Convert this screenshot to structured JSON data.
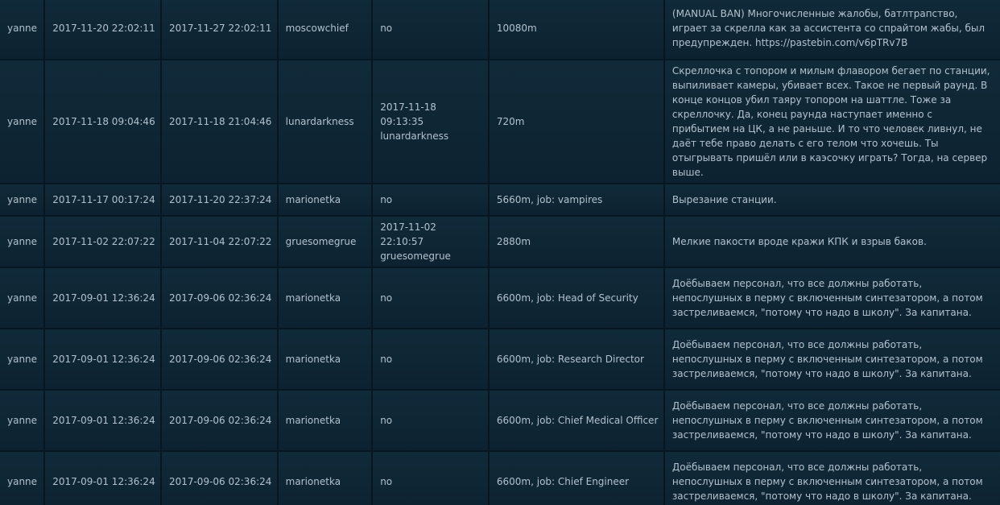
{
  "rows": [
    {
      "ckey": "yanne",
      "banned_at": "2017-11-20 22:02:11",
      "expires_at": "2017-11-27 22:02:11",
      "admin": "moscowchief",
      "unbanned": "no",
      "duration": "10080m",
      "reason": "(MANUAL BAN) Многочисленные жалобы, батлтрапство, играет за скрелла как за ассистента со спрайтом жабы, был предупрежден. https://pastebin.com/v6pTRv7B"
    },
    {
      "ckey": "yanne",
      "banned_at": "2017-11-18 09:04:46",
      "expires_at": "2017-11-18 21:04:46",
      "admin": "lunardarkness",
      "unbanned": "2017-11-18 09:13:35 lunardarkness",
      "duration": "720m",
      "reason": "Скреллочка с топором и милым флавором бегает по станции, выпиливает камеры, убивает всех. Такое не первый раунд. В конце концов убил таяру топором на шаттле. Тоже за скреллочку. Да, конец раунда наступает именно с прибытием на ЦК, а не раньше. И то что человек ливнул, не даёт тебе право делать с его телом что хочешь. Ты отыгрывать пришёл или в каэсочку играть? Тогда, на сервер выше."
    },
    {
      "ckey": "yanne",
      "banned_at": "2017-11-17 00:17:24",
      "expires_at": "2017-11-20 22:37:24",
      "admin": "marionetka",
      "unbanned": "no",
      "duration": "5660m, job: vampires",
      "reason": "Вырезание станции."
    },
    {
      "ckey": "yanne",
      "banned_at": "2017-11-02 22:07:22",
      "expires_at": "2017-11-04 22:07:22",
      "admin": "gruesomegrue",
      "unbanned": "2017-11-02 22:10:57 gruesomegrue",
      "duration": "2880m",
      "reason": "Мелкие пакости вроде кражи КПК и взрыв баков."
    },
    {
      "ckey": "yanne",
      "banned_at": "2017-09-01 12:36:24",
      "expires_at": "2017-09-06 02:36:24",
      "admin": "marionetka",
      "unbanned": "no",
      "duration": "6600m, job: Head of Security",
      "reason": "Доёбываем персонал, что все должны работать, непослушных в перму с включенным синтезатором, а потом застреливаемся, \"потому что надо в школу\". За капитана."
    },
    {
      "ckey": "yanne",
      "banned_at": "2017-09-01 12:36:24",
      "expires_at": "2017-09-06 02:36:24",
      "admin": "marionetka",
      "unbanned": "no",
      "duration": "6600m, job: Research Director",
      "reason": "Доёбываем персонал, что все должны работать, непослушных в перму с включенным синтезатором, а потом застреливаемся, \"потому что надо в школу\". За капитана."
    },
    {
      "ckey": "yanne",
      "banned_at": "2017-09-01 12:36:24",
      "expires_at": "2017-09-06 02:36:24",
      "admin": "marionetka",
      "unbanned": "no",
      "duration": "6600m, job: Chief Medical Officer",
      "reason": "Доёбываем персонал, что все должны работать, непослушных в перму с включенным синтезатором, а потом застреливаемся, \"потому что надо в школу\". За капитана."
    },
    {
      "ckey": "yanne",
      "banned_at": "2017-09-01 12:36:24",
      "expires_at": "2017-09-06 02:36:24",
      "admin": "marionetka",
      "unbanned": "no",
      "duration": "6600m, job: Chief Engineer",
      "reason": "Доёбываем персонал, что все должны работать, непослушных в перму с включенным синтезатором, а потом застреливаемся, \"потому что надо в школу\". За капитана."
    }
  ]
}
